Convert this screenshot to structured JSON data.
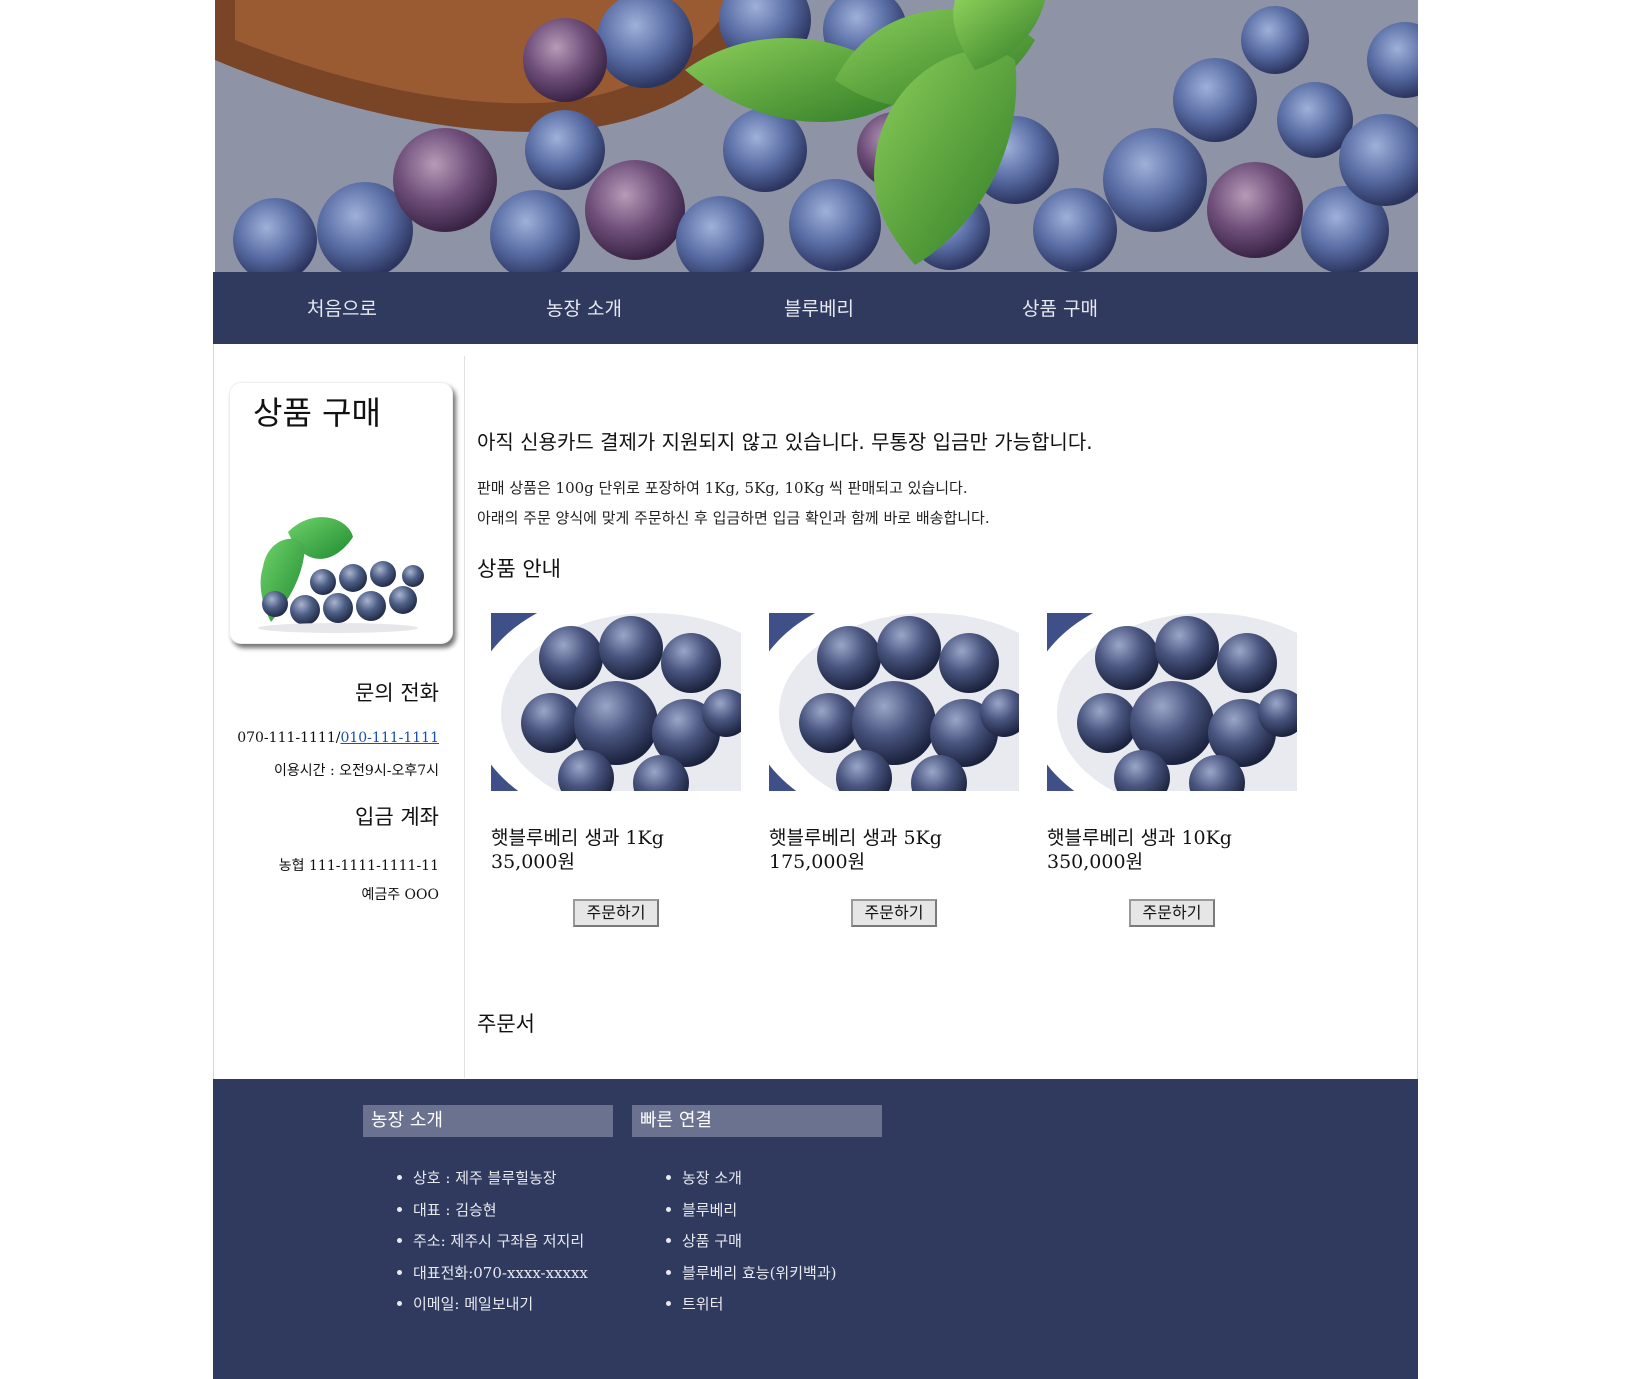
{
  "nav": {
    "items": [
      "처음으로",
      "농장 소개",
      "블루베리",
      "상품 구매"
    ]
  },
  "sidebar": {
    "title": "상품 구매",
    "contact_heading": "문의 전화",
    "phone_main": "070-111-1111/",
    "phone_link": "010-111-1111",
    "hours": "이용시간 : 오전9시-오후7시",
    "account_heading": "입금 계좌",
    "account_number": "농협 111-1111-1111-11",
    "account_holder": "예금주 OOO"
  },
  "main": {
    "notice": "아직 신용카드 결제가 지원되지 않고 있습니다. 무통장 입금만 가능합니다.",
    "desc1": "판매 상품은 100g 단위로 포장하여 1Kg, 5Kg, 10Kg 씩 판매되고 있습니다.",
    "desc2": "아래의 주문 양식에 맞게 주문하신 후 입금하면 입금 확인과 함께 바로 배송합니다.",
    "products_heading": "상품 안내",
    "products": [
      {
        "name": "햇블루베리 생과 1Kg",
        "price": "35,000원",
        "button": "주문하기"
      },
      {
        "name": "햇블루베리 생과 5Kg",
        "price": "175,000원",
        "button": "주문하기"
      },
      {
        "name": "햇블루베리 생과 10Kg",
        "price": "350,000원",
        "button": "주문하기"
      }
    ],
    "order_heading": "주문서"
  },
  "footer": {
    "about": {
      "heading": "농장 소개",
      "items": [
        "상호 : 제주 블루힐농장",
        "대표 : 김승현",
        "주소: 제주시 구좌읍 저지리",
        "대표전화:070-xxxx-xxxxx",
        "이메일: 메일보내기"
      ]
    },
    "links": {
      "heading": "빠른 연결",
      "items": [
        "농장 소개",
        "블루베리",
        "상품 구매",
        "블루베리 효능(위키백과)",
        "트위터"
      ]
    }
  },
  "colors": {
    "nav_bg": "#2f3a5e",
    "footer_heading_bg": "#6b7290",
    "link": "#1a4fb0"
  }
}
